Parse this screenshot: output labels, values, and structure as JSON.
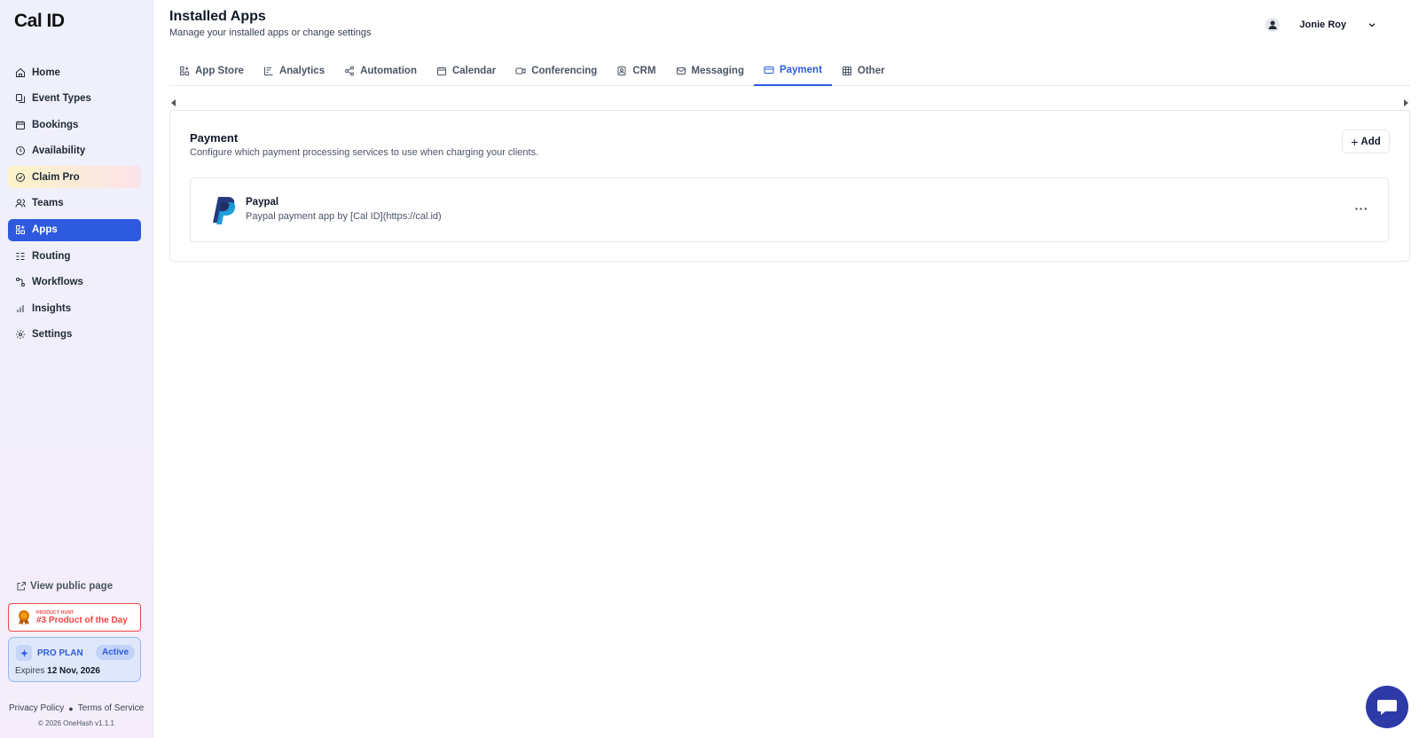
{
  "brand": {
    "logo": "Cal ID"
  },
  "sidebar": {
    "items": [
      {
        "label": "Home",
        "icon": "home-icon"
      },
      {
        "label": "Event Types",
        "icon": "event-types-icon"
      },
      {
        "label": "Bookings",
        "icon": "calendar-icon"
      },
      {
        "label": "Availability",
        "icon": "clock-icon"
      },
      {
        "label": "Claim Pro",
        "icon": "badge-icon"
      },
      {
        "label": "Teams",
        "icon": "users-icon"
      },
      {
        "label": "Apps",
        "icon": "apps-icon",
        "active": true
      },
      {
        "label": "Routing",
        "icon": "routing-icon"
      },
      {
        "label": "Workflows",
        "icon": "workflow-icon"
      },
      {
        "label": "Insights",
        "icon": "chart-icon"
      },
      {
        "label": "Settings",
        "icon": "gear-icon"
      }
    ],
    "view_public": "View public page",
    "product_hunt": {
      "small": "PRODUCT HUNT",
      "big": "#3 Product of the Day"
    },
    "pro_plan": {
      "label": "PRO PLAN",
      "status": "Active",
      "expires_prefix": "Expires",
      "expires_date": "12 Nov, 2026"
    },
    "footer": {
      "privacy": "Privacy Policy",
      "terms": "Terms of Service",
      "copyright": "© 2026 OneHash v1.1.1"
    }
  },
  "header": {
    "title": "Installed Apps",
    "subtitle": "Manage your installed apps or change settings",
    "user_name": "Jonie Roy"
  },
  "tabs": [
    {
      "label": "App Store",
      "icon": "store-icon"
    },
    {
      "label": "Analytics",
      "icon": "analytics-icon"
    },
    {
      "label": "Automation",
      "icon": "share-icon"
    },
    {
      "label": "Calendar",
      "icon": "calendar-icon"
    },
    {
      "label": "Conferencing",
      "icon": "video-icon"
    },
    {
      "label": "CRM",
      "icon": "contact-icon"
    },
    {
      "label": "Messaging",
      "icon": "mail-icon"
    },
    {
      "label": "Payment",
      "icon": "credit-card-icon",
      "active": true
    },
    {
      "label": "Other",
      "icon": "grid-icon"
    }
  ],
  "panel": {
    "title": "Payment",
    "subtitle": "Configure which payment processing services to use when charging your clients.",
    "add_label": "Add",
    "apps": [
      {
        "name": "Paypal",
        "description": "Paypal payment app by [Cal ID](https://cal.id)",
        "more": "···"
      }
    ]
  },
  "colors": {
    "accent": "#2e5ae0",
    "paypal_dark": "#253b80",
    "paypal_light": "#179bd7",
    "chat": "#2d3aa8",
    "ph_red": "#ef4444"
  }
}
